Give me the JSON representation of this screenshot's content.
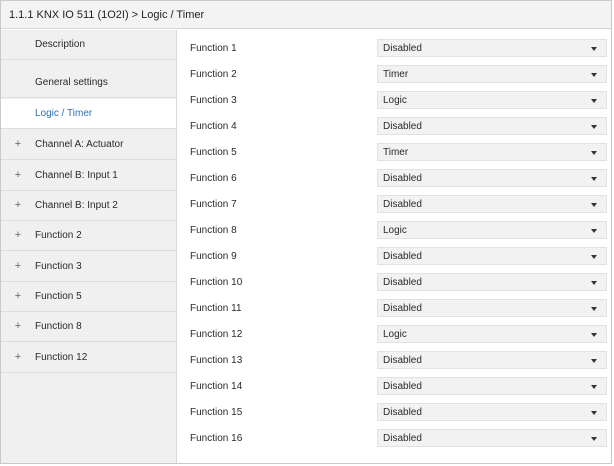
{
  "header": {
    "title": "1.1.1 KNX IO 511 (1O2I) > Logic / Timer"
  },
  "sidebar": {
    "items": [
      {
        "label": "Description",
        "expandable": false,
        "active": false
      },
      {
        "label": "General settings",
        "expandable": false,
        "active": false
      },
      {
        "label": "Logic / Timer",
        "expandable": false,
        "active": true
      },
      {
        "label": "Channel A: Actuator",
        "expandable": true,
        "active": false
      },
      {
        "label": "Channel B: Input 1",
        "expandable": true,
        "active": false
      },
      {
        "label": "Channel B: Input 2",
        "expandable": true,
        "active": false
      },
      {
        "label": "Function 2",
        "expandable": true,
        "active": false
      },
      {
        "label": "Function 3",
        "expandable": true,
        "active": false
      },
      {
        "label": "Function 5",
        "expandable": true,
        "active": false
      },
      {
        "label": "Function 8",
        "expandable": true,
        "active": false
      },
      {
        "label": "Function 12",
        "expandable": true,
        "active": false
      }
    ],
    "expand_symbol": "+"
  },
  "functions": [
    {
      "label": "Function 1",
      "value": "Disabled"
    },
    {
      "label": "Function 2",
      "value": "Timer"
    },
    {
      "label": "Function 3",
      "value": "Logic"
    },
    {
      "label": "Function 4",
      "value": "Disabled"
    },
    {
      "label": "Function 5",
      "value": "Timer"
    },
    {
      "label": "Function 6",
      "value": "Disabled"
    },
    {
      "label": "Function 7",
      "value": "Disabled"
    },
    {
      "label": "Function 8",
      "value": "Logic"
    },
    {
      "label": "Function 9",
      "value": "Disabled"
    },
    {
      "label": "Function 10",
      "value": "Disabled"
    },
    {
      "label": "Function 11",
      "value": "Disabled"
    },
    {
      "label": "Function 12",
      "value": "Logic"
    },
    {
      "label": "Function 13",
      "value": "Disabled"
    },
    {
      "label": "Function 14",
      "value": "Disabled"
    },
    {
      "label": "Function 15",
      "value": "Disabled"
    },
    {
      "label": "Function 16",
      "value": "Disabled"
    }
  ],
  "colors": {
    "active_text": "#2f6fb0",
    "sidebar_bg": "#f0f0f0",
    "select_bg": "#f2f2f2"
  }
}
